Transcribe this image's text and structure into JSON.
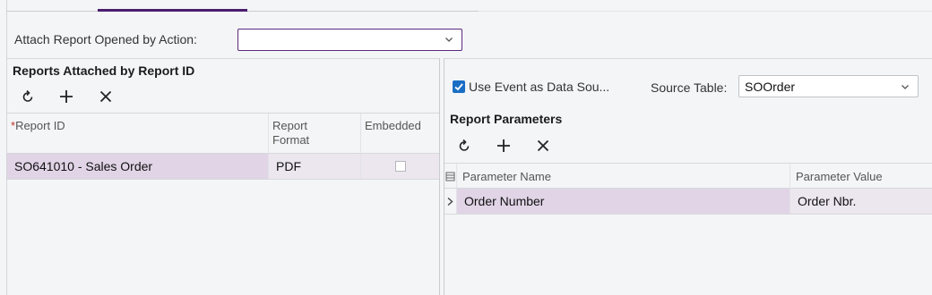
{
  "attach": {
    "label": "Attach Report Opened by Action:",
    "value": ""
  },
  "reports_panel": {
    "title": "Reports Attached by Report ID",
    "toolbar": [
      "refresh-icon",
      "add-icon",
      "delete-icon"
    ],
    "columns": {
      "report_id": "Report ID",
      "report_format_line1": "Report",
      "report_format_line2": "Format",
      "embedded": "Embedded"
    },
    "rows": [
      {
        "report_id": "SO641010 - Sales Order",
        "format": "PDF",
        "embedded": false
      }
    ]
  },
  "params_panel": {
    "use_event_label": "Use Event as Data Sou...",
    "use_event_checked": true,
    "source_table_label": "Source Table:",
    "source_table_value": "SOOrder",
    "title": "Report Parameters",
    "toolbar": [
      "refresh-icon",
      "add-icon",
      "delete-icon"
    ],
    "columns": {
      "name": "Parameter Name",
      "value": "Parameter Value"
    },
    "rows": [
      {
        "name": "Order Number",
        "value": "Order Nbr."
      }
    ]
  },
  "colors": {
    "accent": "#4a1e6e",
    "selected_row": "#e0d4e6",
    "selected_row_alt": "#ece6ef",
    "checkbox": "#1a6fc4"
  }
}
